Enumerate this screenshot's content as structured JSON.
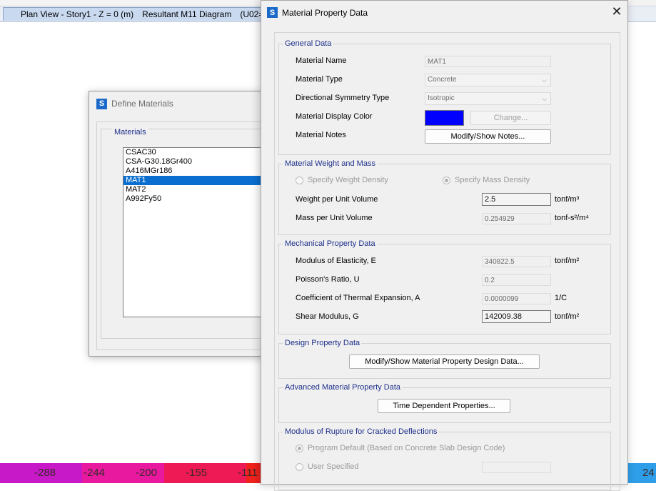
{
  "background_window": {
    "tab_title": "Plan View - Story1 - Z = 0 (m)",
    "diagram_title": "Resultant M11 Diagram",
    "case_text": "(U02="
  },
  "colorbar": {
    "labels": [
      "-288",
      "-244",
      "-200",
      "-155",
      "-111",
      "24"
    ],
    "colors": [
      "#c719c7",
      "#e8199e",
      "#ee1a55",
      "#f1221c",
      "#f25f12",
      "#f79a0a",
      "#f8c40a",
      "#2f9ee8"
    ]
  },
  "define_materials": {
    "title": "Define Materials",
    "materials_label": "Materials",
    "items": [
      "CSAC30",
      "CSA-G30.18Gr400",
      "A416MGr186",
      "MAT1",
      "MAT2",
      "A992Fy50"
    ],
    "selected": "MAT1"
  },
  "material_property": {
    "title": "Material Property Data",
    "general": {
      "group_label": "General Data",
      "name_label": "Material Name",
      "name_value": "MAT1",
      "type_label": "Material Type",
      "type_value": "Concrete",
      "symmetry_label": "Directional Symmetry Type",
      "symmetry_value": "Isotropic",
      "color_label": "Material Display Color",
      "color_value": "#0000ff",
      "change_button": "Change...",
      "notes_label": "Material Notes",
      "notes_button": "Modify/Show Notes..."
    },
    "weight_mass": {
      "group_label": "Material Weight and Mass",
      "radio_weight": "Specify Weight Density",
      "radio_mass": "Specify Mass Density",
      "weight_label": "Weight per Unit Volume",
      "weight_value": "2.5",
      "weight_unit": "tonf/m³",
      "mass_label": "Mass per Unit Volume",
      "mass_value": "0.254929",
      "mass_unit": "tonf-s²/m⁴"
    },
    "mechanical": {
      "group_label": "Mechanical Property Data",
      "e_label": "Modulus of Elasticity,  E",
      "e_value": "340822.5",
      "e_unit": "tonf/m²",
      "u_label": "Poisson's Ratio,  U",
      "u_value": "0.2",
      "a_label": "Coefficient of Thermal Expansion,  A",
      "a_value": "0.0000099",
      "a_unit": "1/C",
      "g_label": "Shear Modulus,  G",
      "g_value": "142009.38",
      "g_unit": "tonf/m²"
    },
    "design": {
      "group_label": "Design Property Data",
      "button": "Modify/Show Material Property Design Data..."
    },
    "advanced": {
      "group_label": "Advanced Material Property Data",
      "button": "Time Dependent Properties..."
    },
    "rupture": {
      "group_label": "Modulus of Rupture for Cracked Deflections",
      "radio_default": "Program Default  (Based on Concrete Slab Design Code)",
      "radio_user": "User Specified"
    }
  }
}
